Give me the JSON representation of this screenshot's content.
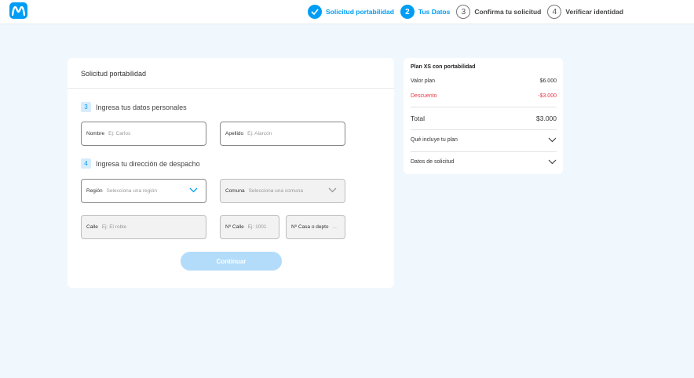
{
  "header": {
    "logo_icon": "movistar-m-icon",
    "steps": [
      {
        "number": "",
        "label": "Solicitud portabilidad",
        "state": "done"
      },
      {
        "number": "2",
        "label": "Tus Datos",
        "state": "active"
      },
      {
        "number": "3",
        "label": "Confirma tu solicitud",
        "state": "pending"
      },
      {
        "number": "4",
        "label": "Verificar identidad",
        "state": "pending"
      }
    ]
  },
  "form": {
    "title": "Solicitud portabilidad",
    "section_personal": {
      "number": "3",
      "label": "Ingresa tus datos personales"
    },
    "nombre": {
      "label": "Nombre",
      "placeholder": "Ej: Carlos"
    },
    "apellido": {
      "label": "Apellido",
      "placeholder": "Ej: Alarcón"
    },
    "section_address": {
      "number": "4",
      "label": "Ingresa tu dirección de despacho"
    },
    "region": {
      "label": "Región",
      "placeholder": "Selecciona una región"
    },
    "comuna": {
      "label": "Comuna",
      "placeholder": "Selecciona una comuna"
    },
    "calle": {
      "label": "Calle",
      "placeholder": "Ej: El roble"
    },
    "num_calle": {
      "label": "Nº Calle",
      "placeholder": "Ej: 1001"
    },
    "casa_depto": {
      "label": "Nº Casa o depto",
      "placeholder": "..."
    },
    "continue_label": "Continuar"
  },
  "summary": {
    "title": "Plan XS con portabilidad",
    "valor_label": "Valor plan",
    "valor_value": "$6.000",
    "descuento_label": "Descuento",
    "descuento_value": "-$3.000",
    "total_label": "Total",
    "total_value": "$3.000",
    "accordion_1": "Qué incluye tu plan",
    "accordion_2": "Datos de solicitud"
  },
  "colors": {
    "accent": "#019df4",
    "background": "#f1f8fd",
    "discount": "#e63946",
    "button_disabled": "#b3dcfa"
  }
}
